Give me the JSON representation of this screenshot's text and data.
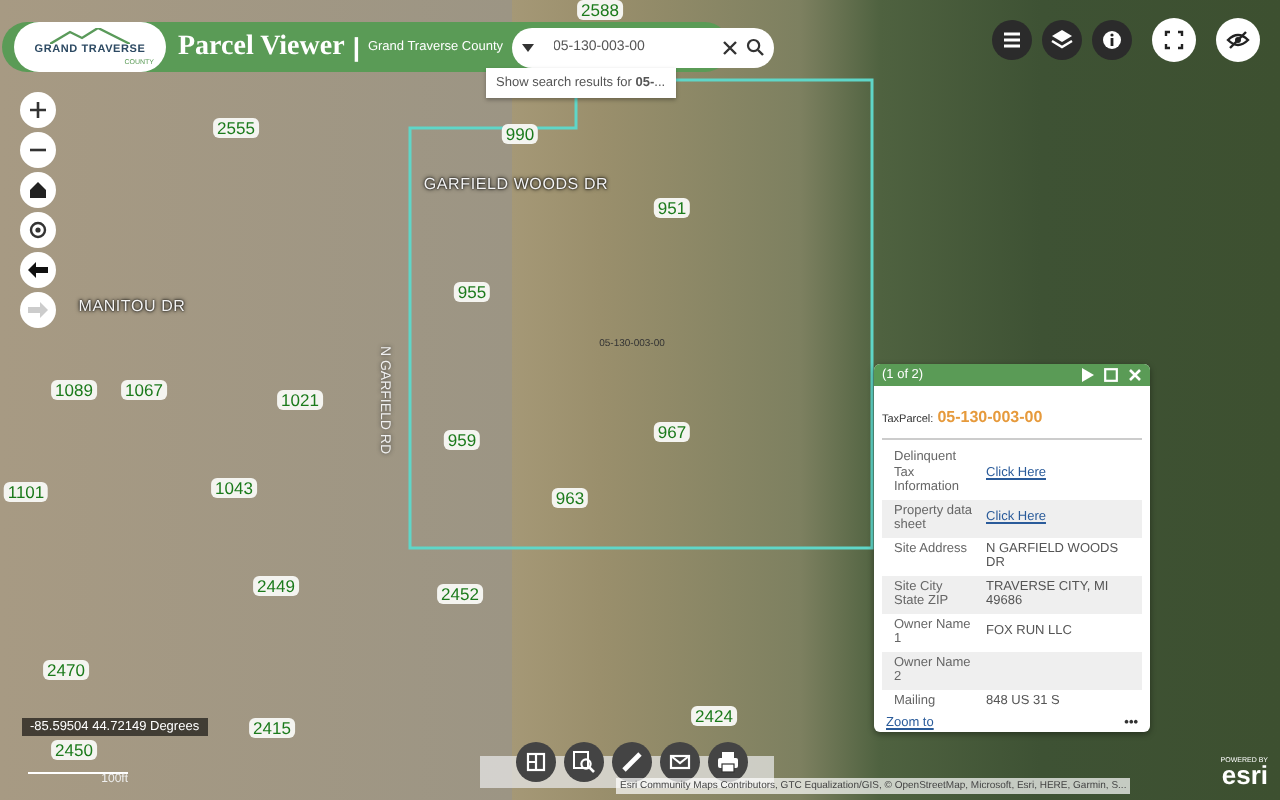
{
  "header": {
    "logo": {
      "name": "GRAND TRAVERSE",
      "sub": "COUNTY"
    },
    "title": "Parcel Viewer",
    "separator": "|",
    "subtitle": "Grand Traverse County"
  },
  "search": {
    "value": "05-130-003-00",
    "suggestion": "Show search results for **05-**..."
  },
  "map_labels": [
    {
      "text": "2588",
      "kind": "address"
    },
    {
      "text": "2555",
      "kind": "address"
    },
    {
      "text": "990",
      "kind": "address"
    },
    {
      "text": "GARFIELD WOODS DR",
      "kind": "street"
    },
    {
      "text": "951",
      "kind": "address"
    },
    {
      "text": "955",
      "kind": "address"
    },
    {
      "text": "MANITOU DR",
      "kind": "street"
    },
    {
      "text": "N GARFIELD RD",
      "kind": "road"
    },
    {
      "text": "05-130-003-00",
      "kind": "parcel"
    },
    {
      "text": "1089",
      "kind": "address"
    },
    {
      "text": "1067",
      "kind": "address"
    },
    {
      "text": "1021",
      "kind": "address"
    },
    {
      "text": "1101",
      "kind": "address"
    },
    {
      "text": "1043",
      "kind": "address"
    },
    {
      "text": "959",
      "kind": "address"
    },
    {
      "text": "967",
      "kind": "address"
    },
    {
      "text": "963",
      "kind": "address"
    },
    {
      "text": "2449",
      "kind": "address"
    },
    {
      "text": "2452",
      "kind": "address"
    },
    {
      "text": "2470",
      "kind": "address"
    },
    {
      "text": "2415",
      "kind": "address"
    },
    {
      "text": "2424",
      "kind": "address"
    },
    {
      "text": "2450",
      "kind": "address"
    }
  ],
  "popup": {
    "counter": "(1 of 2)",
    "title_label": "TaxParcel:",
    "title_value": "05-130-003-00",
    "rows": [
      {
        "label": "Delinquent Tax Information",
        "value": "Click Here",
        "kind": "link"
      },
      {
        "label": "Property data sheet",
        "value": "Click Here",
        "kind": "link"
      },
      {
        "label": "Site Address",
        "value": "N GARFIELD WOODS DR",
        "kind": "text"
      },
      {
        "label": "Site City State ZIP",
        "value": "TRAVERSE CITY, MI 49686",
        "kind": "text"
      },
      {
        "label": "Owner Name 1",
        "value": "FOX RUN LLC",
        "kind": "text"
      },
      {
        "label": "Owner Name 2",
        "kind": "text"
      },
      {
        "label": "Mailing",
        "value": "848 US 31 S",
        "kind": "text"
      }
    ],
    "zoom_link": "Zoom to",
    "more": "•••"
  },
  "coordinates": "-85.59504 44.72149 Degrees",
  "scale": "100ft",
  "attribution": "Esri Community Maps Contributors, GTC Equalization/GIS, © OpenStreetMap, Microsoft, Esri, HERE, Garmin, S...",
  "esri": {
    "powered": "POWERED BY",
    "brand": "esri"
  }
}
